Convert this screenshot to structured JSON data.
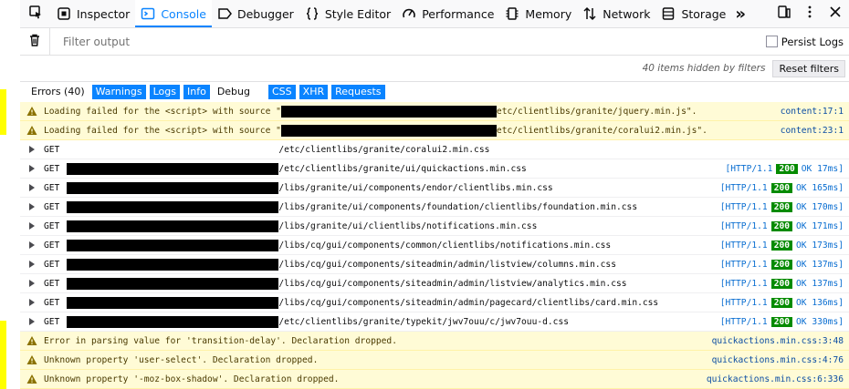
{
  "colors": {
    "accent": "#0a84ff",
    "warning_bg": "#fffbd6",
    "ok_badge": "#058b00",
    "left_marker": "#ffff00"
  },
  "toolbar": {
    "picker_icon": "pick-element-icon",
    "tabs": [
      {
        "label": "Inspector",
        "icon": "inspector-icon"
      },
      {
        "label": "Console",
        "icon": "console-icon"
      },
      {
        "label": "Debugger",
        "icon": "debugger-icon"
      },
      {
        "label": "Style Editor",
        "icon": "style-editor-icon"
      },
      {
        "label": "Performance",
        "icon": "performance-icon"
      },
      {
        "label": "Memory",
        "icon": "memory-icon"
      },
      {
        "label": "Network",
        "icon": "network-icon"
      },
      {
        "label": "Storage",
        "icon": "storage-icon"
      }
    ],
    "selected_tab": "Console",
    "overflow": "»"
  },
  "filter": {
    "placeholder": "Filter output",
    "persist_label": "Persist Logs",
    "persist_checked": false
  },
  "hidden_info": {
    "text": "40 items hidden by filters",
    "reset_label": "Reset filters"
  },
  "levels": {
    "errors": "Errors (40)",
    "warnings": "Warnings",
    "logs": "Logs",
    "info": "Info",
    "debug": "Debug",
    "css": "CSS",
    "xhr": "XHR",
    "requests": "Requests"
  },
  "messages": [
    {
      "type": "warning",
      "prefix": "Loading failed for the <script> with source \"",
      "suffix": "etc/clientlibs/granite/jquery.min.js\".",
      "location": "content:17:1"
    },
    {
      "type": "warning",
      "prefix": "Loading failed for the <script> with source \"",
      "suffix": "etc/clientlibs/granite/coralui2.min.js\".",
      "location": "content:23:1"
    },
    {
      "type": "network",
      "method": "GET",
      "path": "/etc/clientlibs/granite/coralui2.min.css",
      "protocol": "",
      "status": "",
      "time": ""
    },
    {
      "type": "network",
      "method": "GET",
      "path": "/etc/clientlibs/granite/ui/quickactions.min.css",
      "protocol": "[HTTP/1.1",
      "status": "200",
      "time": "OK 17ms]"
    },
    {
      "type": "network",
      "method": "GET",
      "path": "/libs/granite/ui/components/endor/clientlibs.min.css",
      "protocol": "[HTTP/1.1",
      "status": "200",
      "time": "OK 165ms]"
    },
    {
      "type": "network",
      "method": "GET",
      "path": "/libs/granite/ui/components/foundation/clientlibs/foundation.min.css",
      "protocol": "[HTTP/1.1",
      "status": "200",
      "time": "OK 170ms]"
    },
    {
      "type": "network",
      "method": "GET",
      "path": "/libs/granite/ui/clientlibs/notifications.min.css",
      "protocol": "[HTTP/1.1",
      "status": "200",
      "time": "OK 171ms]"
    },
    {
      "type": "network",
      "method": "GET",
      "path": "/libs/cq/gui/components/common/clientlibs/notifications.min.css",
      "protocol": "[HTTP/1.1",
      "status": "200",
      "time": "OK 173ms]"
    },
    {
      "type": "network",
      "method": "GET",
      "path": "/libs/cq/gui/components/siteadmin/admin/listview/columns.min.css",
      "protocol": "[HTTP/1.1",
      "status": "200",
      "time": "OK 137ms]"
    },
    {
      "type": "network",
      "method": "GET",
      "path": "/libs/cq/gui/components/siteadmin/admin/listview/analytics.min.css",
      "protocol": "[HTTP/1.1",
      "status": "200",
      "time": "OK 137ms]"
    },
    {
      "type": "network",
      "method": "GET",
      "path": "/libs/cq/gui/components/siteadmin/admin/pagecard/clientlibs/card.min.css",
      "protocol": "[HTTP/1.1",
      "status": "200",
      "time": "OK 136ms]"
    },
    {
      "type": "network",
      "method": "GET",
      "path": "/etc/clientlibs/granite/typekit/jwv7ouu/c/jwv7ouu-d.css",
      "protocol": "[HTTP/1.1",
      "status": "200",
      "time": "OK 330ms]"
    },
    {
      "type": "warning",
      "prefix": "Error in parsing value for 'transition-delay'.  Declaration dropped.",
      "suffix": "",
      "location": "quickactions.min.css:3:48"
    },
    {
      "type": "warning",
      "prefix": "Unknown property 'user-select'.  Declaration dropped.",
      "suffix": "",
      "location": "quickactions.min.css:4:76"
    },
    {
      "type": "warning",
      "prefix": "Unknown property '-moz-box-shadow'.  Declaration dropped.",
      "suffix": "",
      "location": "quickactions.min.css:6:336"
    }
  ]
}
